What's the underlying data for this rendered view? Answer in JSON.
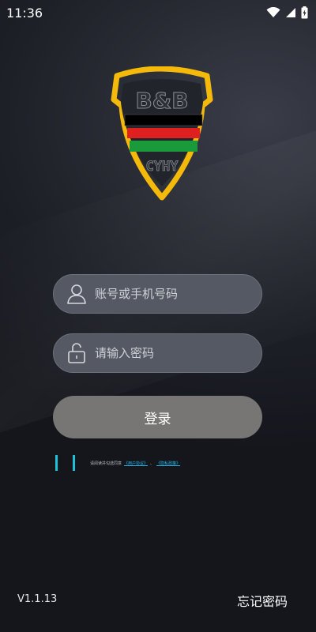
{
  "status_bar": {
    "time": "11:36",
    "icons": [
      "wifi-icon",
      "signal-icon",
      "battery-charging-icon"
    ]
  },
  "logo": {
    "text_top": "B&B",
    "text_bottom": "CYHY",
    "colors": {
      "shield": "#f5b90a",
      "stripe_black": "#000000",
      "stripe_red": "#e01f1f",
      "stripe_green": "#1a9a3a"
    }
  },
  "login_form": {
    "account_placeholder": "账号或手机号码",
    "account_value": "",
    "password_placeholder": "请输入密码",
    "password_value": "",
    "login_label": "登录"
  },
  "agreement": {
    "prefix": "请阅读并勾选同意",
    "link_user": "《用户协议》",
    "separator": "、",
    "link_privacy": "《隐私政策》"
  },
  "footer": {
    "version": "V1.1.13",
    "forgot_password": "忘记密码"
  },
  "colors": {
    "accent": "#1ec1d6",
    "button": "#787575",
    "field_bg": "#545963"
  }
}
